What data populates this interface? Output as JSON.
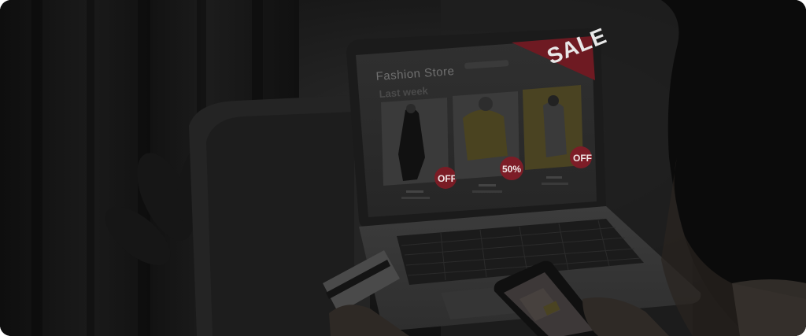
{
  "photo": {
    "subject": "shopping-online-hero-photo",
    "laptop_screen": {
      "site_title": "Fashion Store",
      "section_label": "Last week",
      "sale_banner": "SALE",
      "products": [
        {
          "badge": "OFF"
        },
        {
          "badge": "50%"
        },
        {
          "badge": "OFF"
        }
      ]
    }
  },
  "colors": {
    "background": "#141414",
    "sale_red": "#9c1f2b",
    "badge_red": "#8a1e28",
    "screen": "#2a2a2a",
    "laptop_body": "#3a3a3a"
  }
}
